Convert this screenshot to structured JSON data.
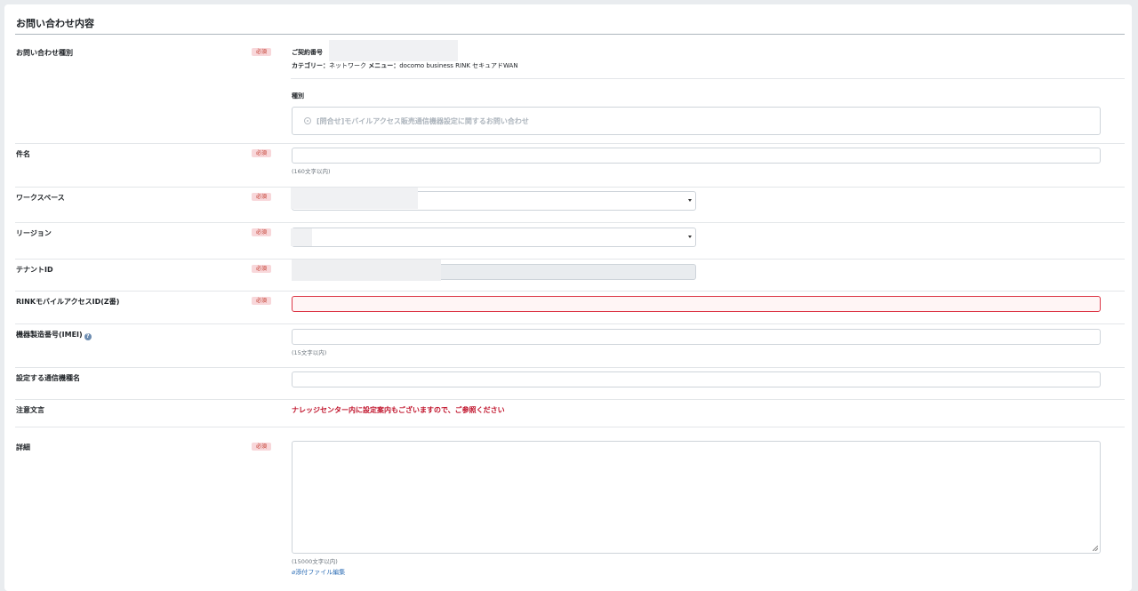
{
  "section_title": "お問い合わせ内容",
  "required_badge": "必須",
  "inquiry_type": {
    "label": "お問い合わせ種別",
    "contract_label": "ご契約番号",
    "category_label": "カテゴリー：",
    "category_value": "ネットワーク",
    "menu_label": "メニュー：",
    "menu_value": "docomo business RINK セキュアドWAN",
    "type_label": "種別",
    "radio_option": "[問合せ]モバイルアクセス販売通信機器設定に関するお問い合わせ"
  },
  "subject": {
    "label": "件名",
    "hint": "(160文字以内)",
    "value": ""
  },
  "workspace": {
    "label": "ワークスペース"
  },
  "region": {
    "label": "リージョン"
  },
  "tenant": {
    "label": "テナントID"
  },
  "rink_id": {
    "label": "RINKモバイルアクセスID(Z番)",
    "value": ""
  },
  "imei": {
    "label": "機器製造番号(IMEI)",
    "info_icon": "info-icon",
    "hint": "(15文字以内)",
    "value": ""
  },
  "device_name": {
    "label": "設定する通信機種名",
    "value": ""
  },
  "notice": {
    "label": "注意文言",
    "text": "ナレッジセンター内に設定案内もございますので、ご参照ください",
    "color": "#c0122a"
  },
  "details": {
    "label": "詳細",
    "hint": "(15000文字以内)",
    "attach_link": "添付ファイル編集",
    "value": ""
  }
}
